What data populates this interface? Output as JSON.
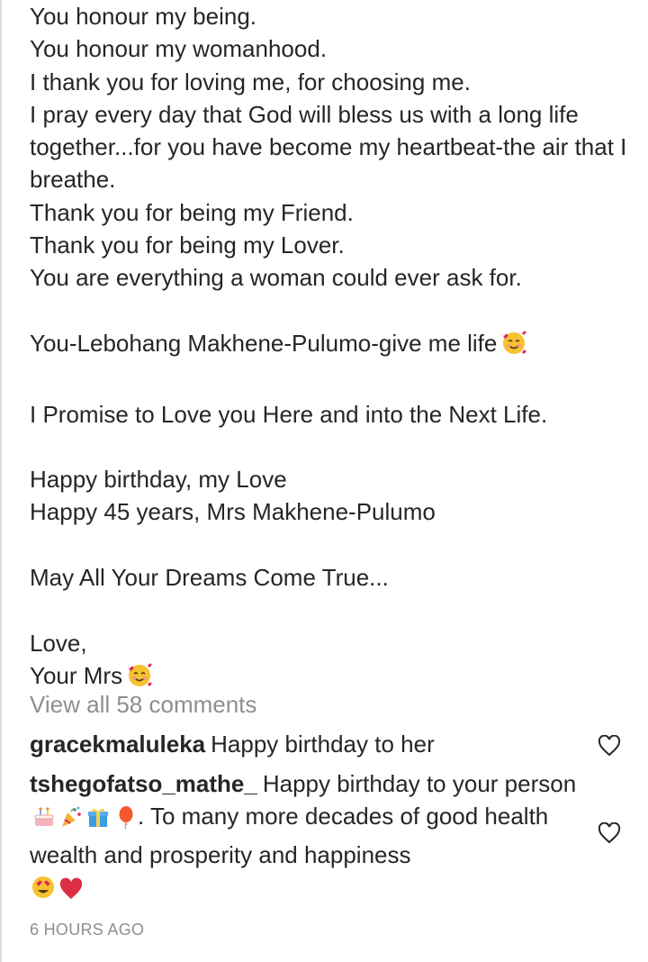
{
  "caption": {
    "lines": [
      "You honour my being.",
      "You honour my womanhood.",
      "I thank you for loving me, for choosing me.",
      "I pray every day that God will bless us with a long life together...for you have become my heartbeat-the air that I breathe.",
      "Thank you for being my Friend.",
      "Thank you for being my Lover.",
      "You are everything a woman could ever ask for.",
      "You-Lebohang Makhene-Pulumo-give me life",
      "I Promise to Love you Here and into the Next Life.",
      "Happy birthday, my Love",
      "Happy 45 years, Mrs Makhene-Pulumo",
      "May All Your Dreams Come True...",
      "Love,",
      "Your Mrs"
    ]
  },
  "comments": {
    "view_all": "View all 58 comments",
    "items": [
      {
        "username": "gracekmaluleka",
        "text": "Happy birthday to her"
      },
      {
        "username": "tshegofatso_mathe_",
        "text_start": "Happy birthday to your person",
        "text_end": ". To many more decades of good health wealth and prosperity and happiness"
      }
    ]
  },
  "timestamp": "6 HOURS AGO",
  "icons": {
    "smiling_hearts": "smiling-face-with-hearts-icon",
    "heart_outline": "heart-outline-icon",
    "cake": "birthday-cake-icon",
    "party_popper": "party-popper-icon",
    "gift": "gift-icon",
    "balloon": "balloon-icon",
    "heart_eyes": "heart-eyes-icon",
    "red_heart": "red-heart-icon"
  },
  "colors": {
    "text": "#262626",
    "muted": "#8e8e8e",
    "emoji_face": "#f7c22f",
    "heart_red": "#e0245e"
  }
}
